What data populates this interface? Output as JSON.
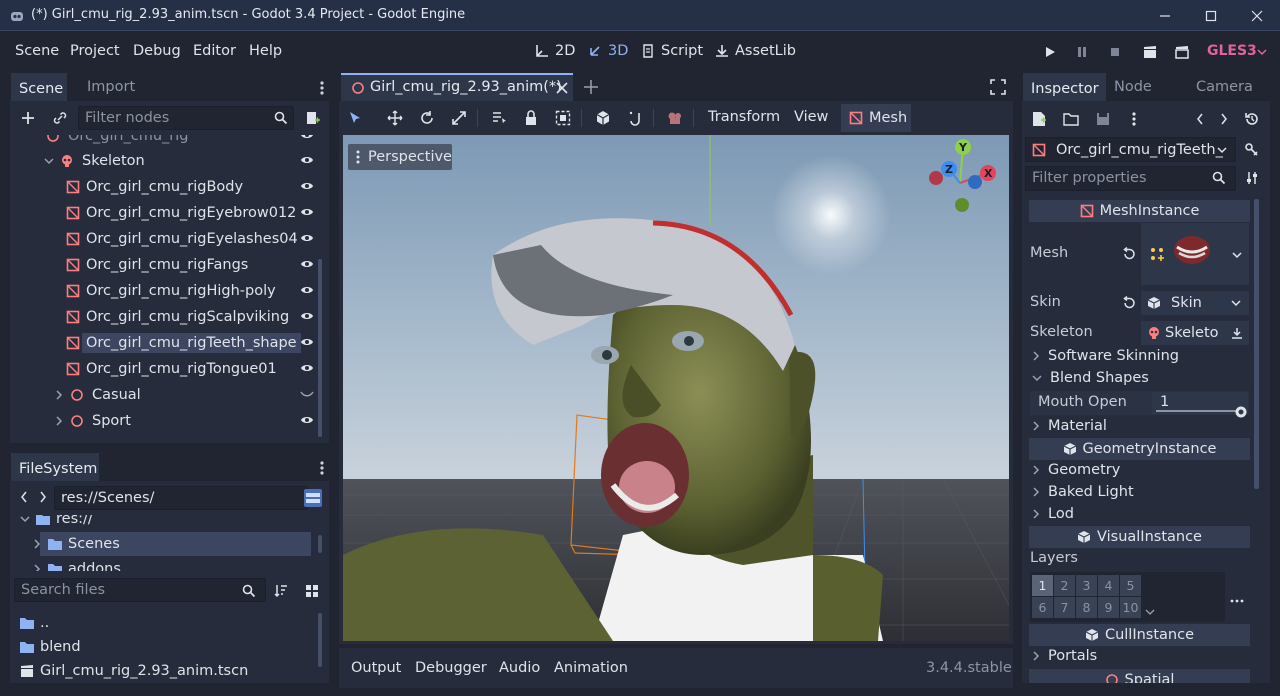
{
  "window": {
    "title": "(*) Girl_cmu_rig_2.93_anim.tscn - Godot 3.4 Project - Godot Engine"
  },
  "menu": [
    "Scene",
    "Project",
    "Debug",
    "Editor",
    "Help"
  ],
  "workspaces": {
    "w2d": "2D",
    "w3d": "3D",
    "script": "Script",
    "assetlib": "AssetLib"
  },
  "renderer": "GLES3",
  "scene_dock": {
    "tabs": [
      "Scene",
      "Import"
    ],
    "filter_placeholder": "Filter nodes",
    "tree": {
      "top_partial": "Orc_girl_cmu_rig",
      "skeleton": "Skeleton",
      "meshes": [
        "Orc_girl_cmu_rigBody",
        "Orc_girl_cmu_rigEyebrow012",
        "Orc_girl_cmu_rigEyelashes04",
        "Orc_girl_cmu_rigFangs",
        "Orc_girl_cmu_rigHigh-poly",
        "Orc_girl_cmu_rigScalpviking",
        "Orc_girl_cmu_rigTeeth_shape",
        "Orc_girl_cmu_rigTongue01"
      ],
      "selected": "Orc_girl_cmu_rigTeeth_shape",
      "spatials": [
        "Casual",
        "Sport"
      ]
    }
  },
  "filesystem": {
    "title": "FileSystem",
    "path": "res://Scenes/",
    "tree": {
      "root_partial": "res://",
      "scenes": "Scenes",
      "addons": "addons"
    },
    "search_placeholder": "Search files",
    "files": [
      "..",
      "blend",
      "Girl_cmu_rig_2.93_anim.tscn"
    ]
  },
  "editor": {
    "scene_tab": "Girl_cmu_rig_2.93_anim(*)",
    "toolbar_menus": {
      "transform": "Transform",
      "view": "View",
      "mesh": "Mesh"
    },
    "perspective_label": "Perspective",
    "gizmo": {
      "y": "Y",
      "x": "X",
      "z": "Z"
    },
    "colors": {
      "sky_top": "#7d99b5",
      "sky_horizon": "#c9d2dc",
      "ground": "#3a3c40",
      "x_axis": "#e5435a",
      "y_axis": "#8ed04a",
      "z_axis": "#3d8ef0"
    }
  },
  "bottom_panel": {
    "tabs": [
      "Output",
      "Debugger",
      "Audio",
      "Animation"
    ],
    "version": "3.4.4.stable"
  },
  "inspector": {
    "tabs": [
      "Inspector",
      "Node",
      "Camera"
    ],
    "object_name": "Orc_girl_cmu_rigTeeth_",
    "filter_placeholder": "Filter properties",
    "mesh_instance_header": "MeshInstance",
    "props": {
      "mesh": "Mesh",
      "skin": "Skin",
      "skin_value": "Skin",
      "skeleton": "Skeleton",
      "skeleton_value": "Skeleto"
    },
    "groups": {
      "software_skinning": "Software Skinning",
      "blend_shapes": "Blend Shapes",
      "material": "Material"
    },
    "mouth_open": {
      "label": "Mouth Open",
      "value": "1"
    },
    "geometry_instance_header": "GeometryInstance",
    "geometry_groups": {
      "geometry": "Geometry",
      "baked_light": "Baked Light",
      "lod": "Lod"
    },
    "visual_instance_header": "VisualInstance",
    "layers_label": "Layers",
    "layer_numbers": [
      "1",
      "2",
      "3",
      "4",
      "5",
      "6",
      "7",
      "8",
      "9",
      "10"
    ],
    "cull_instance_header": "CullInstance",
    "portals": "Portals",
    "spatial_header": "Spatial"
  }
}
